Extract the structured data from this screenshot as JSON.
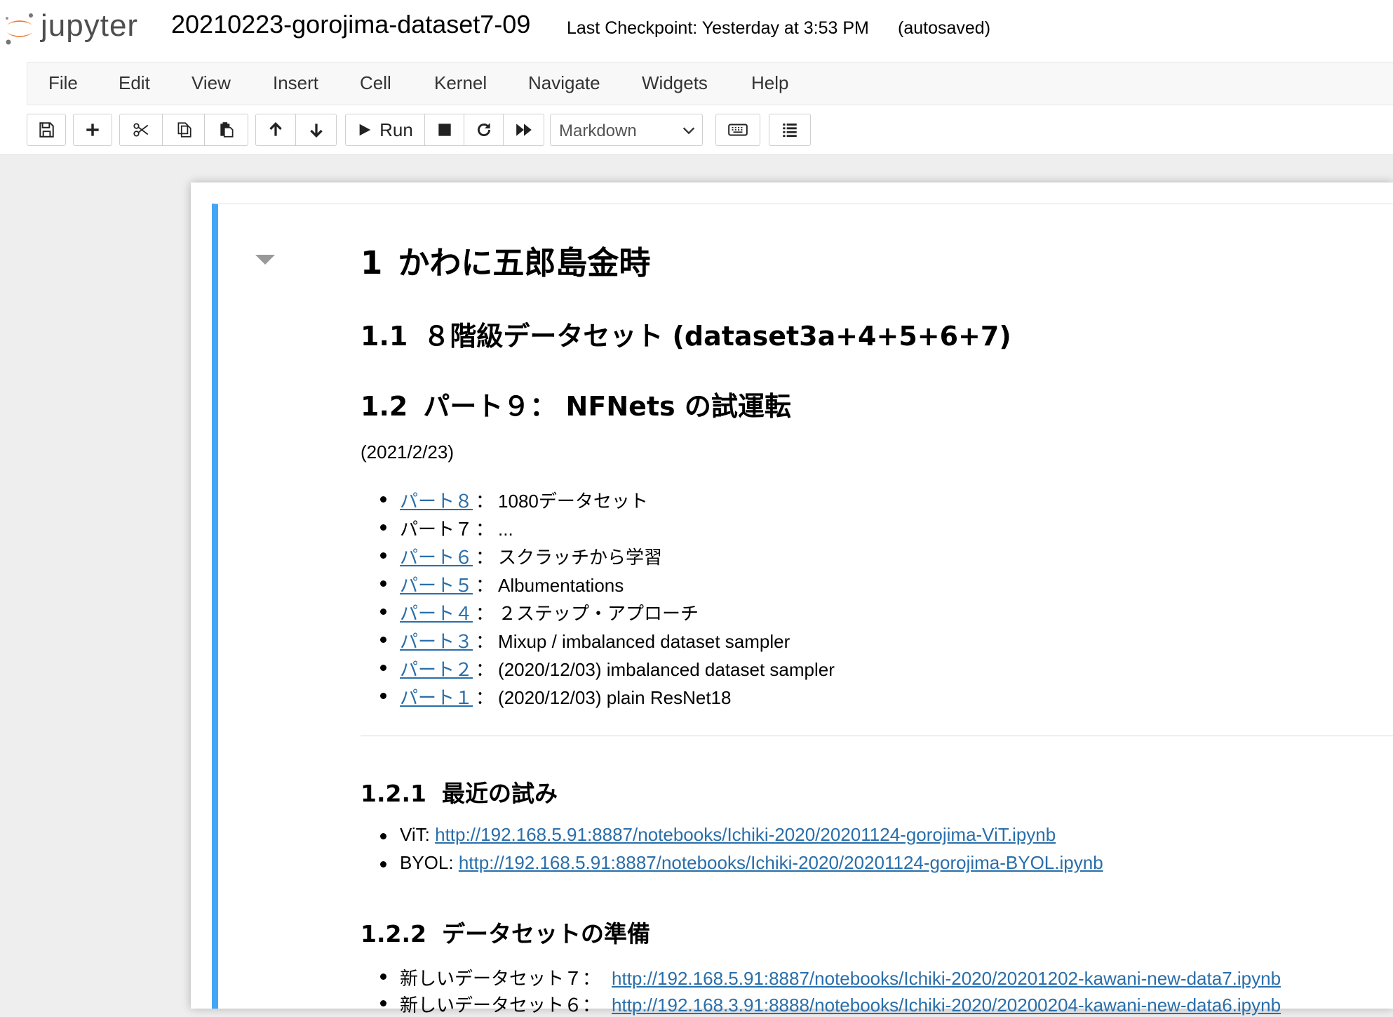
{
  "header": {
    "brand": "jupyter",
    "notebook_name": "20210223-gorojima-dataset7-09",
    "checkpoint": "Last Checkpoint: Yesterday at 3:53 PM",
    "autosave": "(autosaved)"
  },
  "menu": [
    "File",
    "Edit",
    "View",
    "Insert",
    "Cell",
    "Kernel",
    "Navigate",
    "Widgets",
    "Help"
  ],
  "toolbar": {
    "run_label": "Run",
    "cell_type": "Markdown",
    "buttons": [
      "save-icon",
      "plus-icon",
      "scissors-icon",
      "copy-icon",
      "paste-icon",
      "arrow-up-icon",
      "arrow-down-icon",
      "run-icon",
      "stop-icon",
      "restart-icon",
      "fast-forward-icon",
      "keyboard-icon",
      "list-icon"
    ]
  },
  "colors": {
    "accent": "#42a5f5",
    "link": "#296eaa",
    "logo_orange": "#f37726"
  },
  "content": {
    "h1": {
      "num": "1",
      "text": "かわに五郎島金時"
    },
    "h2a": {
      "num": "1.1",
      "text": "８階級データセット (dataset3a+4+5+6+7)"
    },
    "h2b": {
      "num": "1.2",
      "text": "パート９： NFNets の試運転"
    },
    "date": "(2021/2/23)",
    "parts": [
      {
        "link": "パート８",
        "sep": "：",
        "desc": "1080データセット",
        "is_link": true
      },
      {
        "link": "パート７",
        "sep": "：",
        "desc": "...",
        "is_link": false
      },
      {
        "link": "パート６",
        "sep": "：",
        "desc": "スクラッチから学習",
        "is_link": true
      },
      {
        "link": "パート５",
        "sep": "：",
        "desc": "Albumentations",
        "is_link": true
      },
      {
        "link": "パート４",
        "sep": "：",
        "desc": "２ステップ・アプローチ",
        "is_link": true
      },
      {
        "link": "パート３",
        "sep": "：",
        "desc": "Mixup / imbalanced dataset sampler",
        "is_link": true
      },
      {
        "link": "パート２",
        "sep": "：",
        "desc": "(2020/12/03) imbalanced dataset sampler",
        "is_link": true
      },
      {
        "link": "パート１",
        "sep": "：",
        "desc": "(2020/12/03) plain ResNet18",
        "is_link": true
      }
    ],
    "h3a": {
      "num": "1.2.1",
      "text": "最近の試み"
    },
    "recent": [
      {
        "label": "ViT: ",
        "url": "http://192.168.5.91:8887/notebooks/Ichiki-2020/20201124-gorojima-ViT.ipynb"
      },
      {
        "label": "BYOL: ",
        "url": "http://192.168.5.91:8887/notebooks/Ichiki-2020/20201124-gorojima-BYOL.ipynb"
      }
    ],
    "h3b": {
      "num": "1.2.2",
      "text": "データセットの準備"
    },
    "datasets": [
      {
        "label": "新しいデータセット７：",
        "url": "http://192.168.5.91:8887/notebooks/Ichiki-2020/20201202-kawani-new-data7.ipynb"
      },
      {
        "label": "新しいデータセット６：",
        "url": "http://192.168.3.91:8888/notebooks/Ichiki-2020/20200204-kawani-new-data6.ipynb"
      }
    ]
  }
}
